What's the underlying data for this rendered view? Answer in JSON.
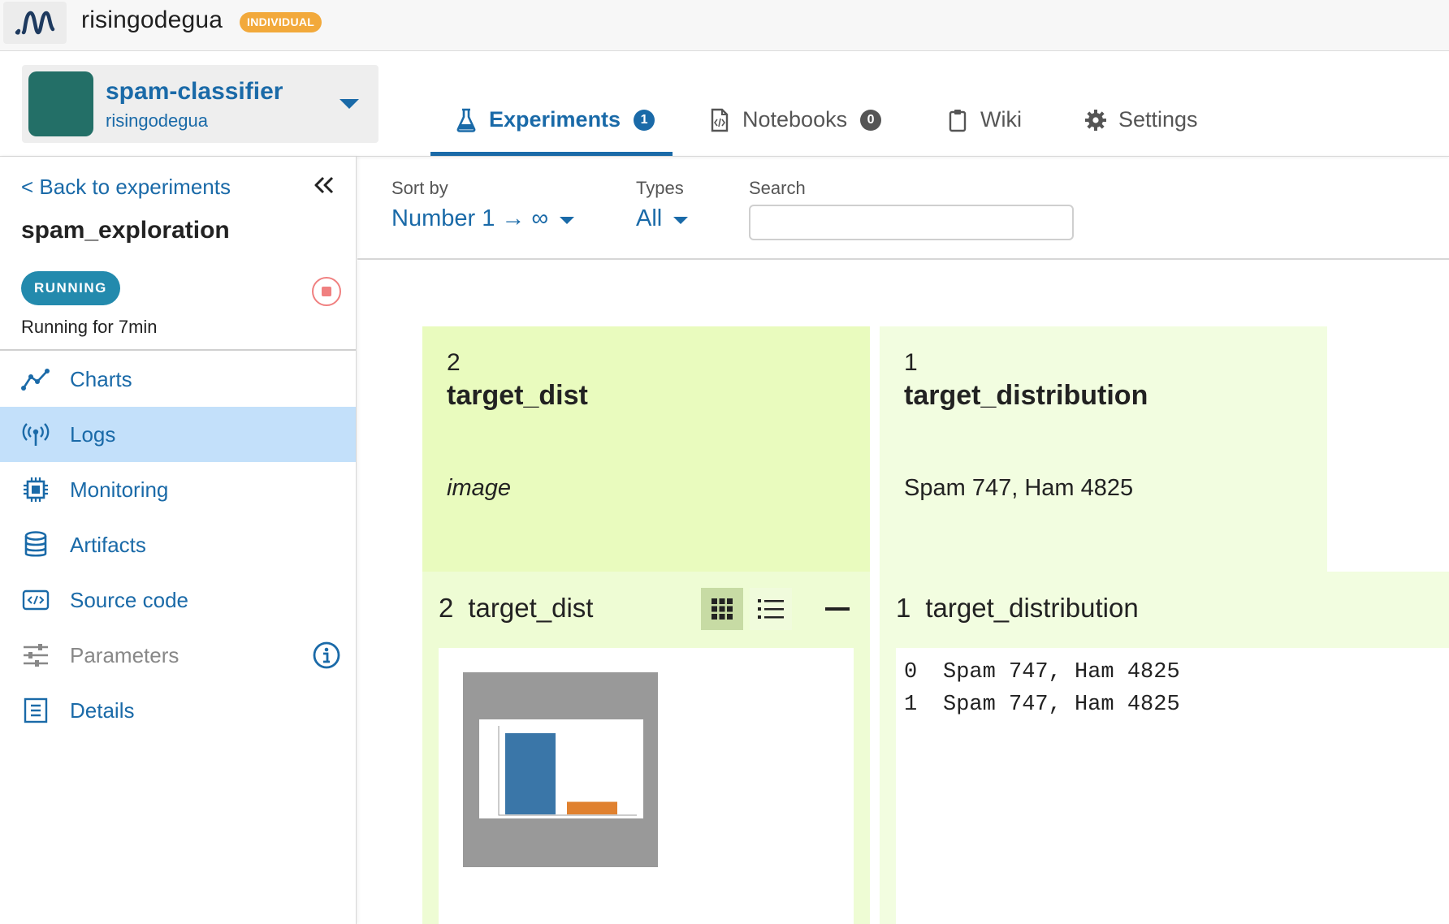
{
  "topbar": {
    "org_name": "risingodegua",
    "plan_badge": "INDIVIDUAL"
  },
  "project": {
    "name": "spam-classifier",
    "owner": "risingodegua"
  },
  "tabs": [
    {
      "label": "Experiments",
      "count": "1",
      "active": true,
      "icon": "flask-icon"
    },
    {
      "label": "Notebooks",
      "count": "0",
      "icon": "notebook-icon"
    },
    {
      "label": "Wiki",
      "icon": "clipboard-icon"
    },
    {
      "label": "Settings",
      "icon": "gear-icon"
    }
  ],
  "sidebar": {
    "back_label": "< Back to experiments",
    "experiment_name": "spam_exploration",
    "status": "RUNNING",
    "running_for": "Running for 7min",
    "items": [
      {
        "label": "Charts",
        "icon": "chart-line-icon"
      },
      {
        "label": "Logs",
        "icon": "antenna-icon",
        "active": true
      },
      {
        "label": "Monitoring",
        "icon": "cpu-icon"
      },
      {
        "label": "Artifacts",
        "icon": "database-icon"
      },
      {
        "label": "Source code",
        "icon": "code-icon"
      },
      {
        "label": "Parameters",
        "icon": "sliders-icon",
        "disabled": true
      },
      {
        "label": "Details",
        "icon": "document-icon"
      }
    ]
  },
  "filters": {
    "sort_label": "Sort by",
    "sort_value": "Number 1 → ∞",
    "types_label": "Types",
    "types_value": "All",
    "search_label": "Search",
    "search_value": "",
    "search_placeholder": ""
  },
  "cards": [
    {
      "number": "2",
      "name": "target_dist",
      "type": "image"
    },
    {
      "number": "1",
      "name": "target_distribution",
      "type": "Spam 747, Ham 4825"
    }
  ],
  "panels": [
    {
      "number": "2",
      "name": "target_dist",
      "thumbnail_chart": {
        "bars": [
          {
            "color": "#3a76a8",
            "value": 4825
          },
          {
            "color": "#e0812f",
            "value": 747
          }
        ]
      }
    },
    {
      "number": "1",
      "name": "target_distribution",
      "lines": [
        {
          "index": "0",
          "text": "Spam 747, Ham 4825"
        },
        {
          "index": "1",
          "text": "Spam 747, Ham 4825"
        }
      ]
    }
  ],
  "colors": {
    "accent": "#1a6aa8",
    "badge": "#f2a93b",
    "status": "#238aad",
    "active_nav": "#c3e0fa",
    "avatar": "#236f67"
  }
}
